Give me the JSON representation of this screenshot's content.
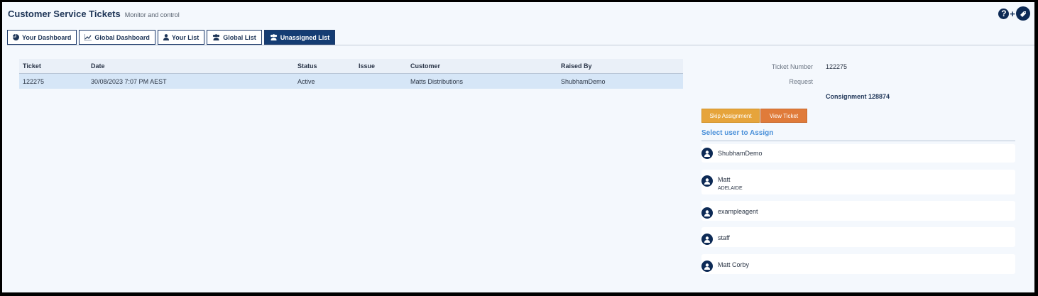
{
  "header": {
    "title": "Customer Service Tickets",
    "subtitle": "Monitor and control",
    "plus": "+"
  },
  "tabs": [
    {
      "label": "Your Dashboard",
      "icon": "pie-chart-icon"
    },
    {
      "label": "Global Dashboard",
      "icon": "line-chart-icon"
    },
    {
      "label": "Your List",
      "icon": "user-icon"
    },
    {
      "label": "Global List",
      "icon": "users-icon"
    },
    {
      "label": "Unassigned List",
      "icon": "users-icon",
      "active": true
    }
  ],
  "table": {
    "columns": [
      "Ticket",
      "Date",
      "Status",
      "Issue",
      "Customer",
      "Raised By"
    ],
    "rows": [
      {
        "ticket": "122275",
        "date": "30/08/2023 7:07 PM AEST",
        "status": "Active",
        "issue": "",
        "customer": "Matts Distributions",
        "raised_by": "ShubhamDemo"
      }
    ]
  },
  "details": {
    "ticket_number_label": "Ticket Number",
    "ticket_number_value": "122275",
    "request_label": "Request",
    "consignment": "Consignment 128874"
  },
  "buttons": {
    "skip": "Skip Assignment",
    "view": "View Ticket"
  },
  "assign": {
    "heading": "Select user to Assign",
    "users": [
      {
        "name": "ShubhamDemo",
        "sub": ""
      },
      {
        "name": "Matt",
        "sub": "ADELAIDE"
      },
      {
        "name": "exampleagent",
        "sub": ""
      },
      {
        "name": "staff",
        "sub": ""
      },
      {
        "name": "Matt Corby",
        "sub": ""
      }
    ]
  },
  "colors": {
    "navy": "#0d2a55",
    "active_tab": "#143c73",
    "skip_button": "#e6a43b",
    "view_button": "#e07b3a",
    "accent_heading": "#4a90d9",
    "selected_row": "#d6e6f7"
  }
}
